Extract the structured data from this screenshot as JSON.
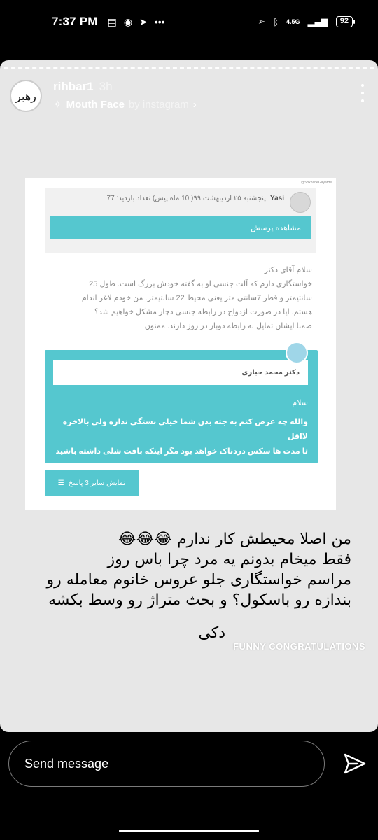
{
  "status": {
    "time": "7:37 PM",
    "network": "4.5G",
    "battery": "92"
  },
  "story": {
    "username": "rihbar1",
    "age": "3h",
    "effect": "Mouth Face",
    "by": "by instagram",
    "avatar_text": "رهبر"
  },
  "shot": {
    "watermark": "@SokhaneGayarde",
    "author": "Yasi",
    "meta": "پنجشنبه ۲۵ اردیبهشت ۹۹( 10 ماه پیش)   تعداد بازدید: 77",
    "view_button": "مشاهده پرسش",
    "question": [
      "سلام آقای دکتر",
      "خواستگاری دارم که آلت جنسی او به گفته خودش بزرگ است. طول 25",
      "سانتیمتر و قطر 7سانتی متر یعنی محیط 22 سانتیمتر. من خودم لاغر اندام",
      "هستم. ایا در صورت ازدواج در رابطه جنسی دچار مشکل خواهیم شد؟",
      "ضمنا ایشان تمایل به رابطه دوبار در روز دارند. ممنون"
    ],
    "answer_name": "دکتر محمد جباری",
    "answer_greeting": "سلام",
    "answer_body": [
      "والله چه عرض کنم به جثه بدن شما خیلی بستگی نداره ولی بالاخره لااقل",
      "تا مدت ها سکس دردناک خواهد بود مگر اینکه بافت شلی داشته باشید"
    ],
    "more_button": "نمایش سایر 3 پاسخ"
  },
  "caption": {
    "line1": "من اصلا محیطش کار ندارم 😂😂😂",
    "line2": "فقط میخام بدونم یه مرد چرا باس روز",
    "line3": "مراسم خواستگاری جلو عروس خانوم معامله رو",
    "line4": "بندازه رو باسکول؟ و بحث متراژ رو وسط بکشه",
    "line5": "دکی"
  },
  "sticker": "FUNNY CONGRATULATIONS",
  "message": {
    "placeholder": "Send message"
  }
}
